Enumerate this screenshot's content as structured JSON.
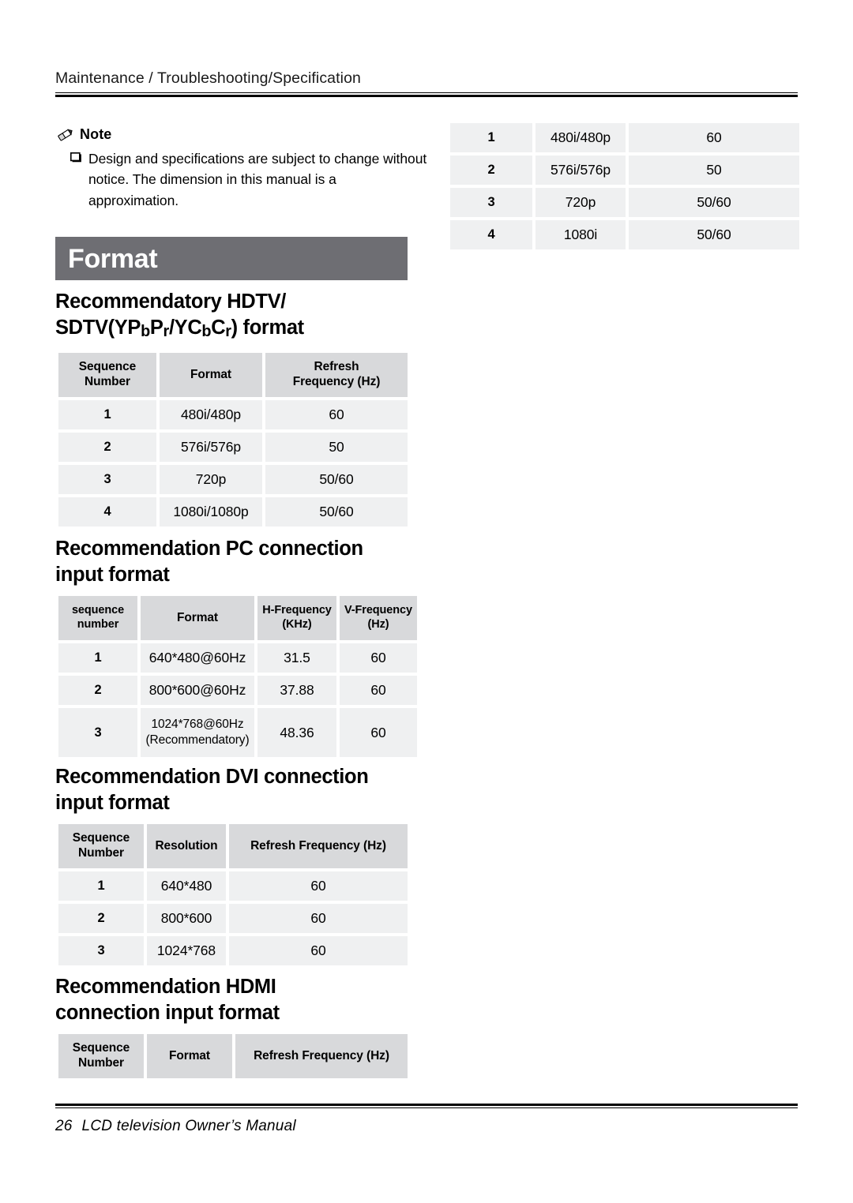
{
  "header": {
    "breadcrumb": "Maintenance / Troubleshooting/Specification"
  },
  "note": {
    "icon": "pencil-icon",
    "label": "Note",
    "bullet_icon": "hollow-square-bullet-icon",
    "text": "Design and specifications are subject to change without notice. The dimension in this manual is a approximation."
  },
  "banner": {
    "title": "Format",
    "background_color": "#6e6e73",
    "text_color": "#ffffff"
  },
  "colors": {
    "table_header_bg": "#d8d9db",
    "table_cell_bg": "#eff0f1",
    "rule": "#000000"
  },
  "top_right_table": {
    "rows": [
      [
        "1",
        "480i/480p",
        "60"
      ],
      [
        "2",
        "576i/576p",
        "50"
      ],
      [
        "3",
        "720p",
        "50/60"
      ],
      [
        "4",
        "1080i",
        "50/60"
      ]
    ]
  },
  "sections": [
    {
      "id": "hdtv",
      "heading_line1": "Recommendatory HDTV/",
      "heading_line2_pre": "SDTV(YP",
      "heading_line2_sub1": "b",
      "heading_line2_mid1": "P",
      "heading_line2_sub2": "r",
      "heading_line2_mid2": "/YC",
      "heading_line2_sub3": "b",
      "heading_line2_mid3": "C",
      "heading_line2_sub4": "r",
      "heading_line2_post": ") format",
      "table": {
        "headers": [
          "Sequence\nNumber",
          "Format",
          "Refresh\nFrequency (Hz)"
        ],
        "header_l1": [
          "Sequence",
          "Format",
          "Refresh"
        ],
        "header_l2": [
          "Number",
          "",
          "Frequency (Hz)"
        ],
        "rows": [
          [
            "1",
            "480i/480p",
            "60"
          ],
          [
            "2",
            "576i/576p",
            "50"
          ],
          [
            "3",
            "720p",
            "50/60"
          ],
          [
            "4",
            "1080i/1080p",
            "50/60"
          ]
        ]
      }
    },
    {
      "id": "pc",
      "heading_line1": "Recommendation PC connection",
      "heading_line2": "input format",
      "table": {
        "header_l1": [
          "sequence",
          "Format",
          "H-Frequency",
          "V-Frequency"
        ],
        "header_l2": [
          "number",
          "",
          "(KHz)",
          "(Hz)"
        ],
        "rows": [
          [
            "1",
            "640*480@60Hz",
            "",
            "31.5",
            "60"
          ],
          [
            "2",
            "800*600@60Hz",
            "",
            "37.88",
            "60"
          ],
          [
            "3",
            "1024*768@60Hz",
            "(Recommendatory)",
            "48.36",
            "60"
          ]
        ]
      }
    },
    {
      "id": "dvi",
      "heading_line1": "Recommendation DVI connection",
      "heading_line2": "input format",
      "table": {
        "header_l1": [
          "Sequence",
          "Resolution",
          "Refresh Frequency (Hz)"
        ],
        "header_l2": [
          "Number",
          "",
          ""
        ],
        "rows": [
          [
            "1",
            "640*480",
            "60"
          ],
          [
            "2",
            "800*600",
            "60"
          ],
          [
            "3",
            "1024*768",
            "60"
          ]
        ]
      }
    },
    {
      "id": "hdmi",
      "heading_line1": "Recommendation HDMI",
      "heading_line2": "connection input format",
      "table": {
        "header_l1": [
          "Sequence",
          "Format",
          "Refresh Frequency (Hz)"
        ],
        "header_l2": [
          "Number",
          "",
          ""
        ],
        "rows": []
      }
    }
  ],
  "footer": {
    "page_number": "26",
    "text": "LCD  television  Owner’s Manual"
  }
}
